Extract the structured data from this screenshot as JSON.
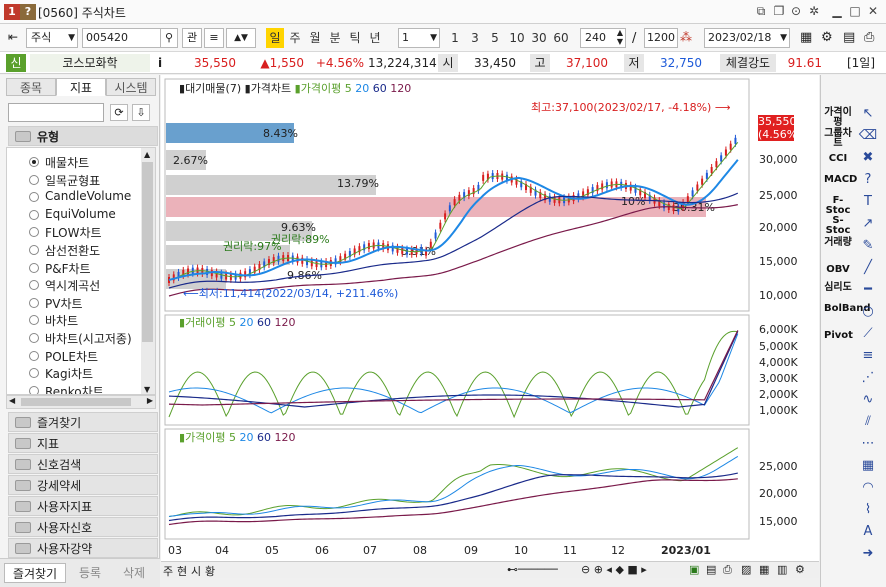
{
  "window": {
    "title": "[0560] 주식차트",
    "icon1": "1",
    "icon2": "?",
    "right_icons": [
      "restore-window-icon",
      "copy-icon",
      "camera-icon",
      "gear-icon",
      "minimize-icon",
      "maximize-icon",
      "close-icon"
    ]
  },
  "toolbar": {
    "market_select": "주식",
    "code_value": "005420",
    "search_button": "관",
    "period_buttons": [
      "일",
      "주",
      "월",
      "분",
      "틱",
      "년"
    ],
    "active_period": "일",
    "interval_select": "1",
    "interval_buttons": [
      "1",
      "3",
      "5",
      "10",
      "30",
      "60"
    ],
    "count_value": "240",
    "total_value": "1200",
    "slash": "/",
    "date_value": "2023/02/18"
  },
  "pricebar": {
    "sin_label": "신",
    "stock_name": "코스모화학",
    "info_icon": "i",
    "price": "35,550",
    "change": "▲1,550",
    "change_pct": "+4.56%",
    "volume": "13,224,314",
    "open_label": "시",
    "open": "33,450",
    "high_label": "고",
    "high": "37,100",
    "low_label": "저",
    "low": "32,750",
    "strength_label": "체결강도",
    "strength": "91.61",
    "period_label": "[1일]"
  },
  "leftpanel": {
    "tabs": [
      "종목",
      "지표",
      "시스템"
    ],
    "active_tab": "지표",
    "search_placeholder": "",
    "group_title": "유형",
    "items": [
      "매물차트",
      "일목균형표",
      "CandleVolume",
      "EquiVolume",
      "FLOW차트",
      "삼선전환도",
      "P&F차트",
      "역시계곡선",
      "PV차트",
      "바차트",
      "바차트(시고저종)",
      "POLE차트",
      "Kagi차트",
      "Renko차트"
    ],
    "selected_item": "매물차트",
    "folders": [
      "즐겨찾기",
      "지표",
      "신호검색",
      "강세약세",
      "사용자지표",
      "사용자신호",
      "사용자강약"
    ],
    "bottom_tabs": [
      "즐겨찾기",
      "등록",
      "삭제"
    ]
  },
  "chart": {
    "main_legend": {
      "vol_profile": "대기매물(7)",
      "price": "가격차트",
      "ma_label": "가격이평",
      "ma_periods": [
        "5",
        "20",
        "60",
        "120"
      ]
    },
    "volume_legend": {
      "ma_label": "거래이평",
      "ma_periods": [
        "5",
        "20",
        "60",
        "120"
      ]
    },
    "third_legend": {
      "ma_label": "가격이평",
      "ma_periods": [
        "5",
        "20",
        "60",
        "120"
      ]
    },
    "high_annotation": "최고:37,100(2023/02/17, -4.18%)",
    "low_annotation": "최저:11,414(2022/03/14, +211.46%)",
    "current_price_box": "35,550",
    "current_pct_box": "(4.56%)",
    "rights_label_1": "권리락:97%",
    "rights_label_2": "권리락:89%",
    "vp_labels": [
      "8.43%",
      "2.67%",
      "13.79%",
      "9.63%",
      "9.86%",
      "5.91%",
      "30.31%",
      "10%"
    ],
    "price_axis": [
      "30,000",
      "25,000",
      "20,000",
      "15,000",
      "10,000"
    ],
    "volume_axis": [
      "6,000K",
      "5,000K",
      "4,000K",
      "3,000K",
      "2,000K",
      "1,000K"
    ],
    "third_axis": [
      "25,000",
      "20,000",
      "15,000"
    ],
    "x_axis": [
      "03",
      "04",
      "05",
      "06",
      "07",
      "08",
      "09",
      "10",
      "11",
      "12",
      "2023/01"
    ],
    "colors": {
      "ma5": "#5aa02c",
      "ma20": "#1e88e5",
      "ma60": "#1a2a8a",
      "ma120": "#7a1a4a",
      "up": "#d81e1e",
      "down": "#1e5ad8",
      "vp_gray": "#c8c8c8",
      "vp_blue": "#4f8fc6",
      "vp_pink": "#e8a5ae"
    }
  },
  "bottombar": {
    "tabs": [
      "주",
      "현",
      "시",
      "황"
    ]
  },
  "righttool": {
    "labels": [
      "가격이평",
      "그룹차트",
      "CCI",
      "MACD",
      "F-Stoc",
      "S-Stoc",
      "거래량",
      "OBV",
      "심리도",
      "BolBand",
      "Pivot"
    ],
    "icons": [
      "cursor-icon",
      "eraser-icon",
      "delete-icon",
      "help-icon",
      "text-icon",
      "trend-icon",
      "pen-icon",
      "line-icon",
      "ruler-icon",
      "circle-icon",
      "diagonal-icon",
      "fib-icon",
      "gann-icon",
      "cycle-icon",
      "channel-icon",
      "fan-icon",
      "grid-icon",
      "arc-icon",
      "chart-icon",
      "auto-icon",
      "arrow-icon"
    ]
  }
}
